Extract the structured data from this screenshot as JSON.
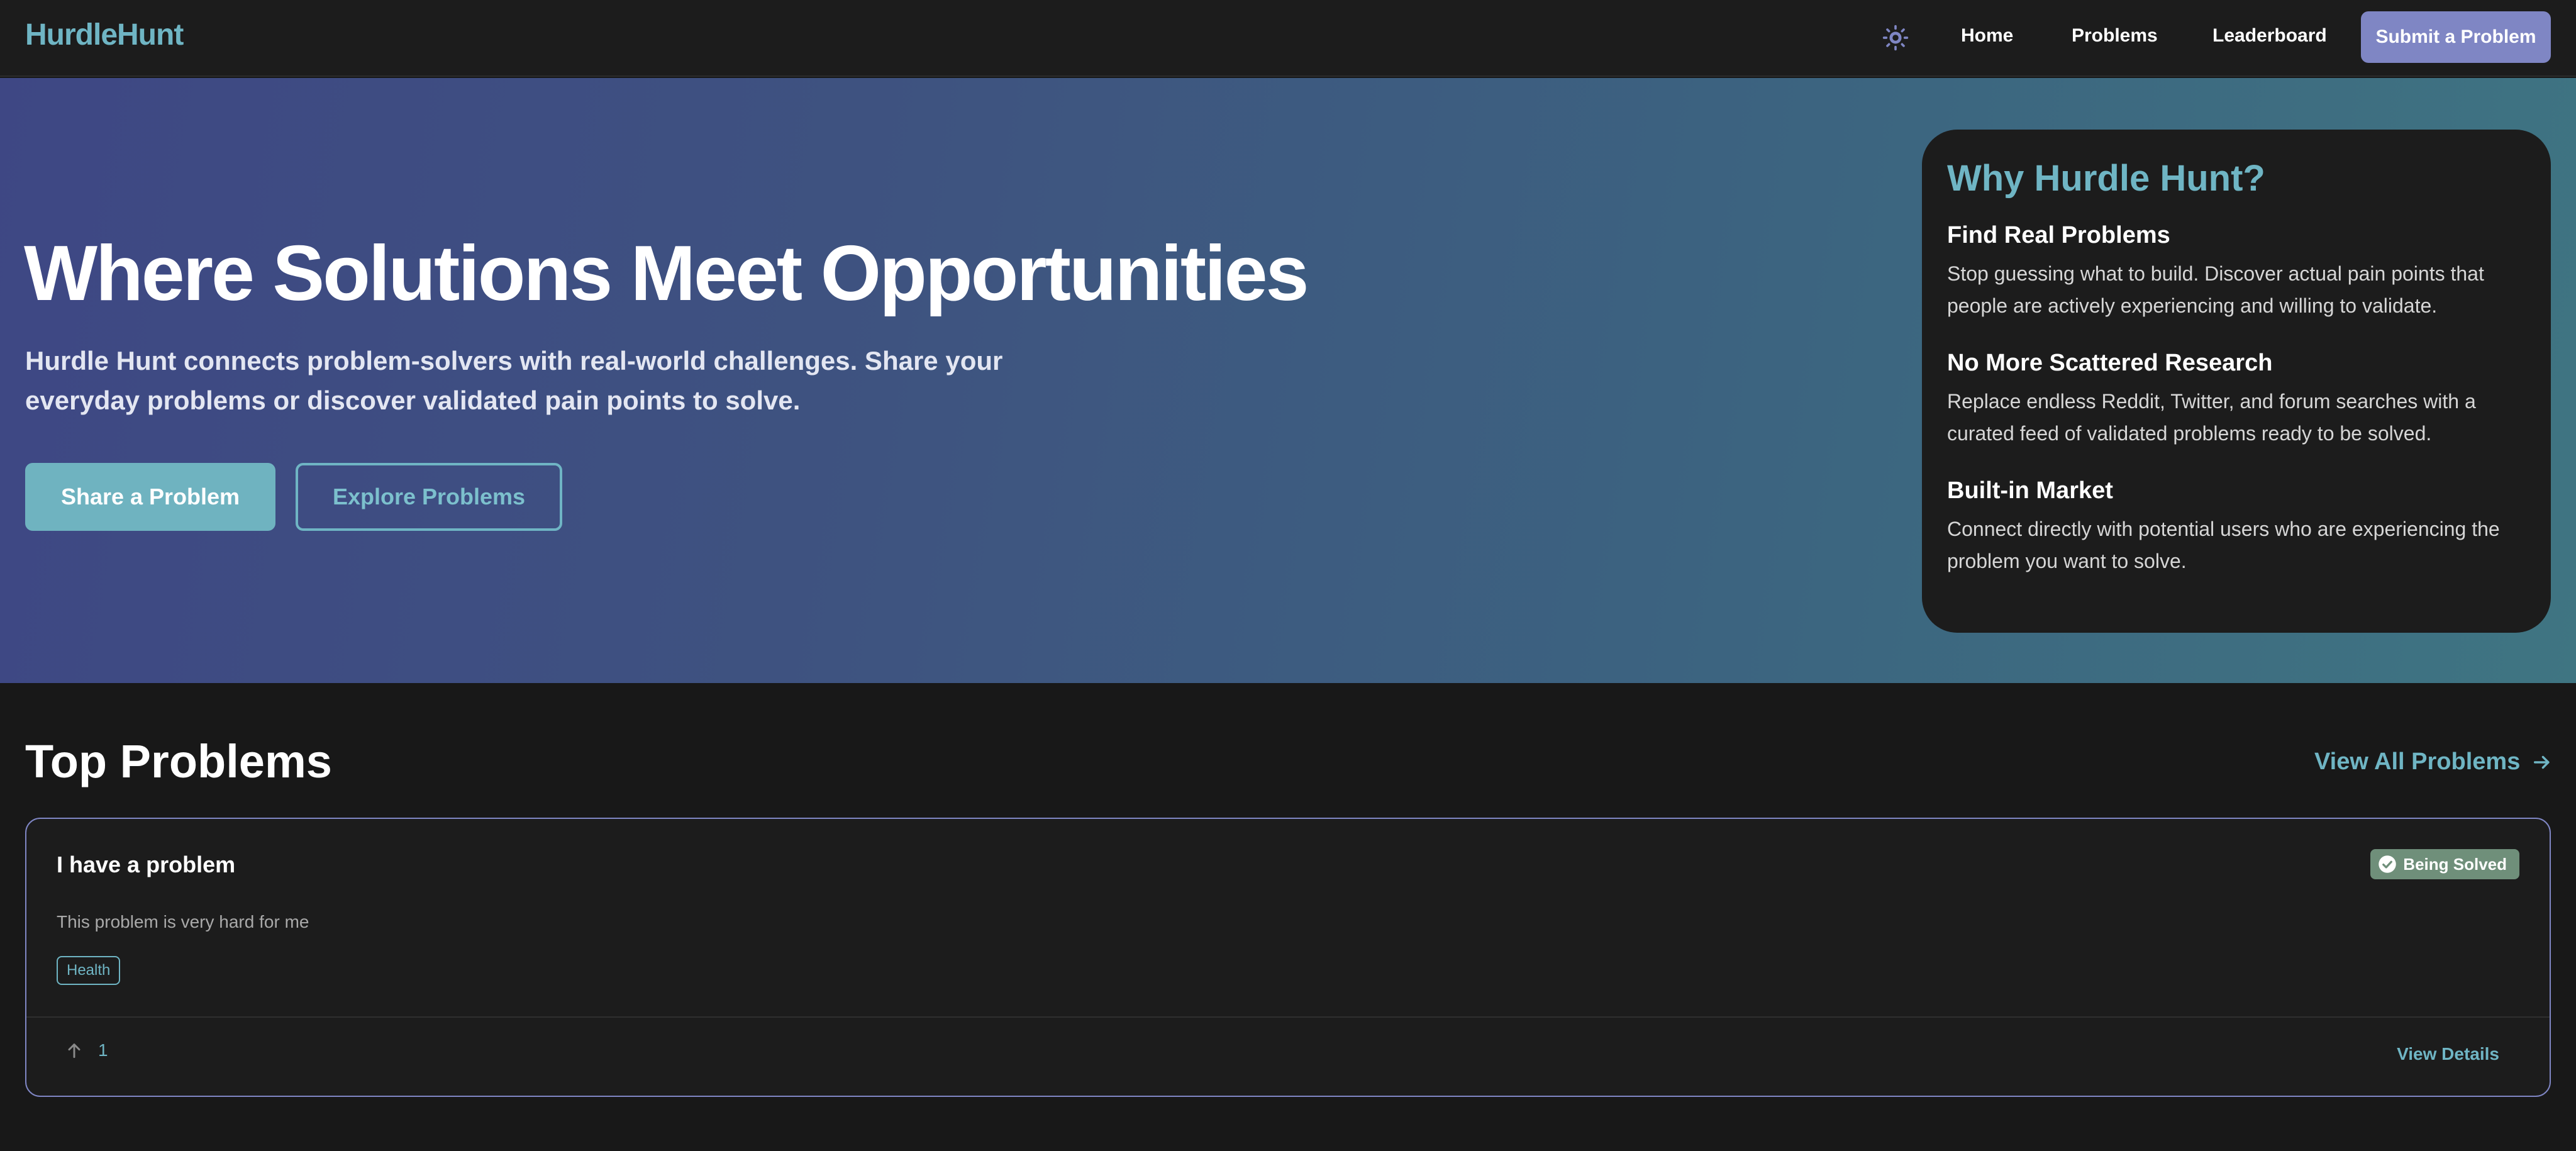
{
  "nav": {
    "brand": "HurdleHunt",
    "links": [
      "Home",
      "Problems",
      "Leaderboard"
    ],
    "submit_label": "Submit a Problem",
    "theme_icon": "sun-icon"
  },
  "hero": {
    "title": "Where Solutions Meet Opportunities",
    "subtitle": "Hurdle Hunt connects problem-solvers with real-world challenges. Share your everyday problems or discover validated pain points to solve.",
    "primary_button": "Share a Problem",
    "secondary_button": "Explore Problems"
  },
  "why": {
    "title": "Why Hurdle Hunt?",
    "items": [
      {
        "heading": "Find Real Problems",
        "text": "Stop guessing what to build. Discover actual pain points that people are actively experiencing and willing to validate."
      },
      {
        "heading": "No More Scattered Research",
        "text": "Replace endless Reddit, Twitter, and forum searches with a curated feed of validated problems ready to be solved."
      },
      {
        "heading": "Built-in Market",
        "text": "Connect directly with potential users who are experiencing the problem you want to solve."
      }
    ]
  },
  "top_problems": {
    "title": "Top Problems",
    "view_all": "View All Problems",
    "problems": [
      {
        "title": "I have a problem",
        "status": "Being Solved",
        "description": "This problem is very hard for me",
        "tags": [
          "Health"
        ],
        "upvotes": "1",
        "details_label": "View Details"
      }
    ]
  },
  "colors": {
    "accent": "#6fb5c4",
    "primary": "#7f86c4",
    "background": "#181818",
    "card": "#1c1c1c",
    "status_badge": "#6f8f7a"
  }
}
